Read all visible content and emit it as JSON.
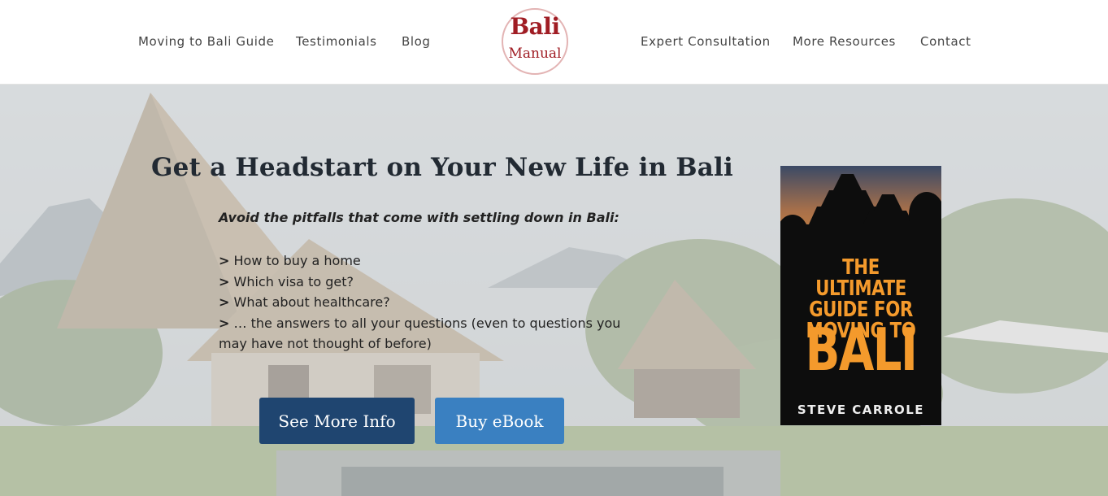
{
  "header": {
    "nav_left": [
      "Moving to Bali Guide",
      "Testimonials",
      "Blog"
    ],
    "nav_right": [
      "Expert Consultation",
      "More Resources",
      "Contact"
    ],
    "logo": {
      "line1": "Bali",
      "line2": "Manual"
    }
  },
  "hero": {
    "headline": "Get a Headstart on Your New Life in Bali",
    "subhead": "Avoid the pitfalls that come with settling down in Bali:",
    "bullet_marker": ">",
    "bullets": [
      "How to buy a home",
      "Which visa to get?",
      "What about healthcare?",
      "… the answers to all your questions (even to questions you may have not thought of before)"
    ],
    "buttons": {
      "info": "See More Info",
      "buy": "Buy eBook"
    }
  },
  "book": {
    "title": "THE ULTIMATE GUIDE FOR MOVING TO",
    "title_lines": [
      "THE ULTIMATE",
      "GUIDE FOR",
      "MOVING TO"
    ],
    "big": "BALI",
    "author": "STEVE CARROLE"
  },
  "colors": {
    "logo_red": "#a01d24",
    "button_dark": "#1f4570",
    "button_light": "#3a80c1",
    "book_orange": "#f49a2c"
  }
}
